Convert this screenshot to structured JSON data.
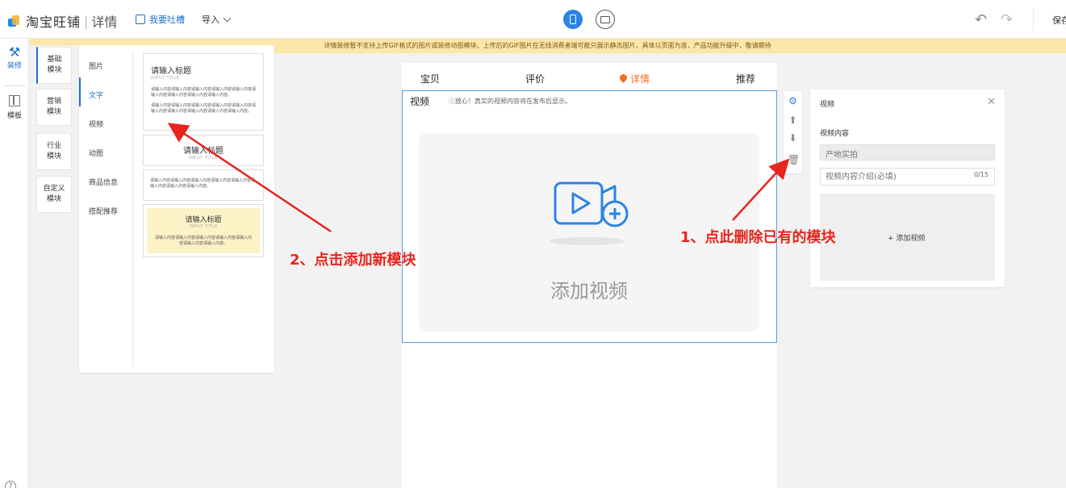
{
  "topbar": {
    "logo_text": "淘宝旺铺",
    "logo_sub": "详情",
    "complain_label": "我要吐槽",
    "import_label": "导入",
    "save_label": "保存"
  },
  "notice": "详情装修暂不支持上传GIF格式的图片或装修动图模块，上传后的GIF图片在无线消费者端可能只展示静态图片，具体以页面为准，产品功能升级中，敬请期待",
  "rail": {
    "decorate_label": "装修",
    "template_label": "模板",
    "help_label": "?"
  },
  "categories": [
    "基础\n模块",
    "营销\n模块",
    "行业\n模块",
    "自定义\n模块"
  ],
  "subcategories": [
    "图片",
    "文字",
    "视频",
    "动图",
    "商品信息",
    "搭配推荐"
  ],
  "thumbs": {
    "t1_title": "请输入标题",
    "t1_sub": "INPUT TITLE",
    "t1_p1": "请输入内容请输入内容请输入内容请输入内容请输入内容请输入内容请输入内容请输入内容请输入内容。",
    "t1_p2": "请输入内容请输入内容请输入内容请输入内容请输入内容请输入内容请输入内容请输入内容请输入内容请输入内容。",
    "t2_title": "请输入标题",
    "t2_sub": "INPUT TITLE",
    "t3_text": "请输入内容请输入内容请输入内容请输入内容请输入内容请输入内容请输入内容请输入内容。",
    "t4_title": "请输入标题",
    "t4_sub": "INPUT TITLE",
    "t4_text": "请输入内容请输入内容请输入内容请输入内容请输入内容请输入内容请输入内容。"
  },
  "preview": {
    "tabs": [
      "宝贝",
      "评价",
      "详情",
      "推荐"
    ],
    "active_tab": "详情",
    "video_title": "视频",
    "video_tip": "ⓘ放心！真实的视频内容将在发布后显示。",
    "add_video": "添加视频"
  },
  "settings": {
    "title": "视频",
    "content_label": "视频内容",
    "select_value": "产地实拍",
    "intro_placeholder": "视频内容介绍(必填)",
    "counter": "0/15",
    "upload_label": "+ 添加视频"
  },
  "annotations": {
    "a1": "1、点此删除已有的模块",
    "a2": "2、点击添加新模块"
  },
  "colors": {
    "accent": "#1e6fcf",
    "active_tab": "#f07020",
    "annotation": "#e8241c",
    "notice_bg": "#fbe7a8"
  }
}
